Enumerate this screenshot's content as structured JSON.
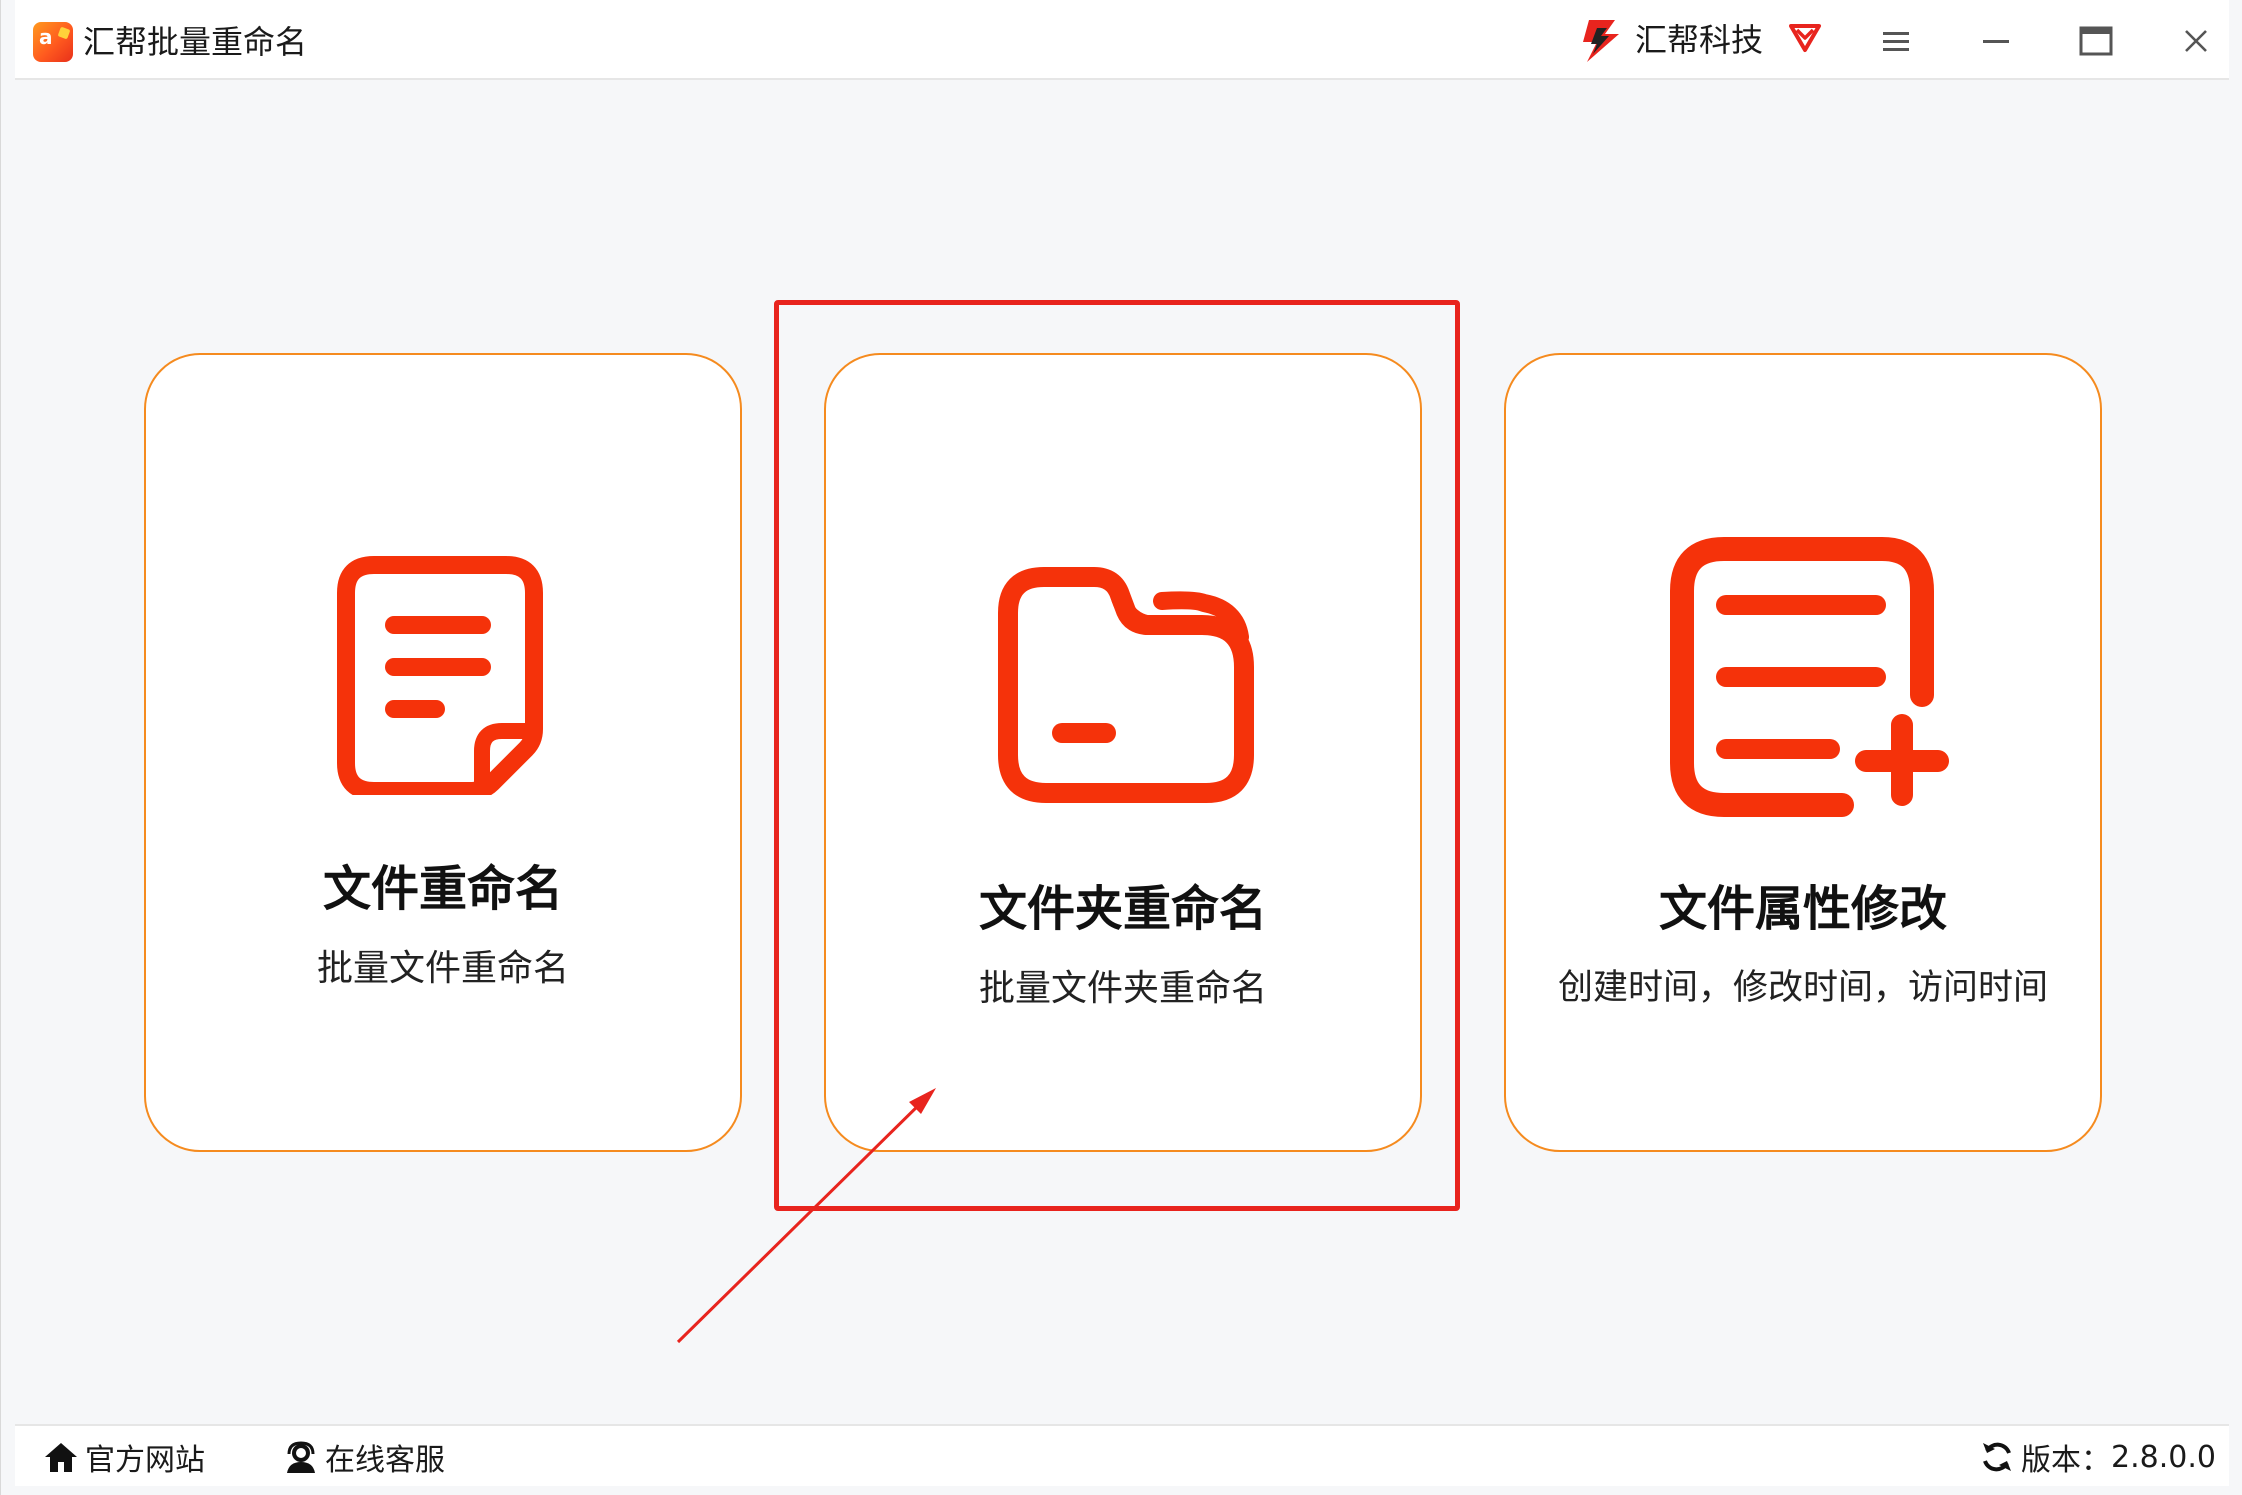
{
  "titlebar": {
    "app_title": "汇帮批量重命名",
    "app_logo_text": "a",
    "brand_name": "汇帮科技",
    "brand_icon": "huibang-logo-icon",
    "vip_icon": "diamond-vip-icon",
    "menu_icon": "hamburger-menu-icon",
    "minimize_icon": "minimize-icon",
    "maximize_icon": "maximize-icon",
    "close_icon": "close-icon"
  },
  "cards": [
    {
      "title": "文件重命名",
      "subtitle": "批量文件重命名",
      "icon": "document-icon"
    },
    {
      "title": "文件夹重命名",
      "subtitle": "批量文件夹重命名",
      "icon": "folder-icon"
    },
    {
      "title": "文件属性修改",
      "subtitle": "创建时间，修改时间，访问时间",
      "icon": "list-add-icon"
    }
  ],
  "statusbar": {
    "website_label": "官方网站",
    "service_label": "在线客服",
    "version_label": "版本：",
    "version_value": "2.8.0.0"
  },
  "colors": {
    "accent_icon": "#f5320a",
    "card_border": "#f58b1f",
    "annotation": "#e8241e",
    "background": "#f6f7f9"
  }
}
